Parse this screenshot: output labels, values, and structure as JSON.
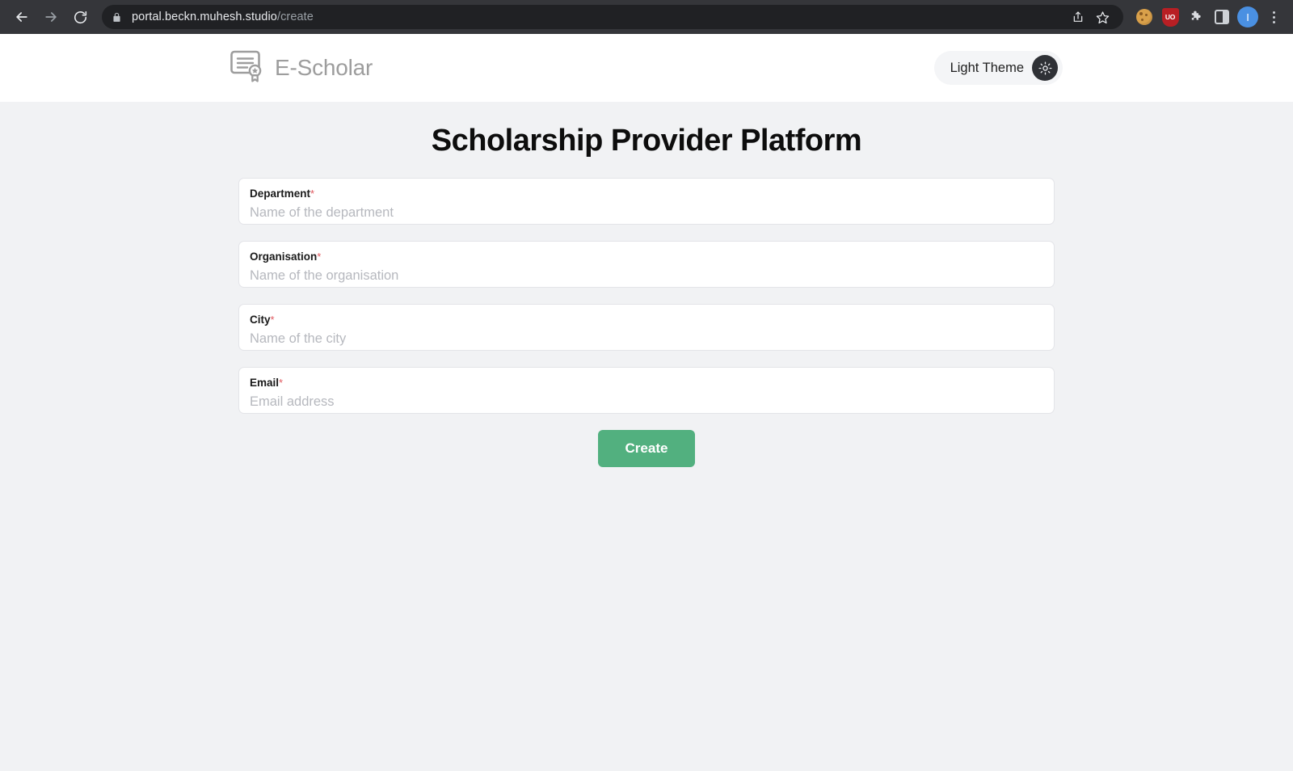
{
  "browser": {
    "back_icon": "back-arrow-icon",
    "forward_icon": "forward-arrow-icon",
    "reload_icon": "reload-icon",
    "lock_icon": "lock-icon",
    "url_domain": "portal.beckn.muhesh.studio",
    "url_path": "/create",
    "share_icon": "share-icon",
    "bookmark_icon": "star-icon",
    "extensions": [
      {
        "name": "cookie-extension-icon"
      },
      {
        "name": "shield-extension-icon",
        "label": "UO"
      },
      {
        "name": "puzzle-extensions-icon"
      },
      {
        "name": "side-panel-icon"
      }
    ],
    "profile_initial": "I",
    "menu_icon": "kebab-menu-icon"
  },
  "header": {
    "logo_icon": "certificate-logo-icon",
    "logo_text": "E-Scholar",
    "theme_toggle_label": "Light Theme",
    "theme_toggle_icon": "sun-icon"
  },
  "page": {
    "title": "Scholarship Provider Platform"
  },
  "form": {
    "required_marker": "*",
    "fields": [
      {
        "label": "Department",
        "placeholder": "Name of the department",
        "value": ""
      },
      {
        "label": "Organisation",
        "placeholder": "Name of the organisation",
        "value": ""
      },
      {
        "label": "City",
        "placeholder": "Name of the city",
        "value": ""
      },
      {
        "label": "Email",
        "placeholder": "Email address",
        "value": ""
      }
    ],
    "submit_label": "Create"
  },
  "colors": {
    "accent_green": "#52b07f",
    "page_background": "#f1f2f4",
    "header_background": "#ffffff",
    "required_red": "#e0585f",
    "logo_gray": "#9d9d9d"
  }
}
